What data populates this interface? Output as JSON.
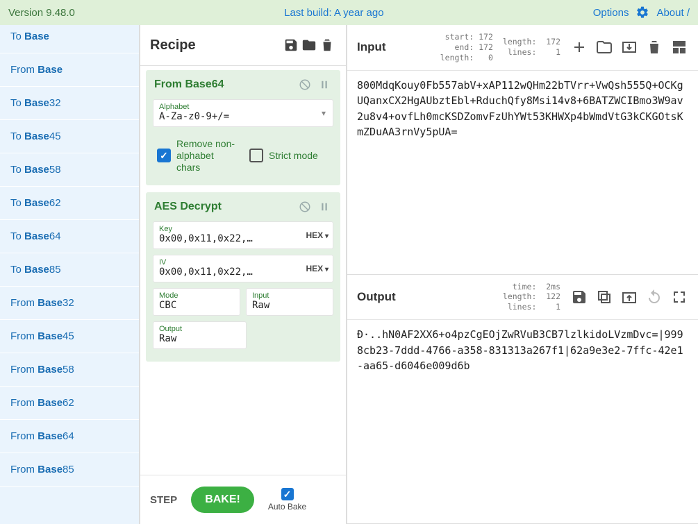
{
  "topbar": {
    "version": "Version 9.48.0",
    "last_build": "Last build: A year ago",
    "options": "Options",
    "about": "About /"
  },
  "sidebar": {
    "items": [
      {
        "pre": "To ",
        "bold": "Base",
        "partial": true
      },
      {
        "pre": "From ",
        "bold": "Base"
      },
      {
        "pre": "To ",
        "bold": "Base",
        "post": "32"
      },
      {
        "pre": "To ",
        "bold": "Base",
        "post": "45"
      },
      {
        "pre": "To ",
        "bold": "Base",
        "post": "58"
      },
      {
        "pre": "To ",
        "bold": "Base",
        "post": "62"
      },
      {
        "pre": "To ",
        "bold": "Base",
        "post": "64"
      },
      {
        "pre": "To ",
        "bold": "Base",
        "post": "85"
      },
      {
        "pre": "From ",
        "bold": "Base",
        "post": "32"
      },
      {
        "pre": "From ",
        "bold": "Base",
        "post": "45"
      },
      {
        "pre": "From ",
        "bold": "Base",
        "post": "58"
      },
      {
        "pre": "From ",
        "bold": "Base",
        "post": "62"
      },
      {
        "pre": "From ",
        "bold": "Base",
        "post": "64"
      },
      {
        "pre": "From ",
        "bold": "Base",
        "post": "85"
      }
    ]
  },
  "recipe": {
    "title": "Recipe",
    "ops": [
      {
        "name": "From Base64",
        "alphabet": {
          "label": "Alphabet",
          "value": "A-Za-z0-9+/="
        },
        "remove_label": "Remove non-alphabet chars",
        "remove_checked": true,
        "strict_label": "Strict mode",
        "strict_checked": false
      },
      {
        "name": "AES Decrypt",
        "key": {
          "label": "Key",
          "value": "0x00,0x11,0x22,…",
          "suffix": "HEX"
        },
        "iv": {
          "label": "IV",
          "value": "0x00,0x11,0x22,…",
          "suffix": "HEX"
        },
        "mode": {
          "label": "Mode",
          "value": "CBC"
        },
        "input": {
          "label": "Input",
          "value": "Raw"
        },
        "output": {
          "label": "Output",
          "value": "Raw"
        }
      }
    ],
    "step": "STEP",
    "bake": "BAKE!",
    "autobake": "Auto Bake",
    "autobake_checked": true
  },
  "input": {
    "title": "Input",
    "stats1": " start: 172\n   end: 172\nlength:   0",
    "stats2": "length:  172\n lines:    1",
    "text": "800MdqKouy0Fb557abV+xAP112wQHm22bTVrr+VwQsh555Q+OCKgUQanxCX2HgAUbztEbl+RduchQfy8Msi14v8+6BATZWCIBmo3W9av2u8v4+ovfLh0mcKSDZomvFzUhYWt53KHWXp4bWmdVtG3kCKGOtsKmZDuAA3rnVy5pUA="
  },
  "output": {
    "title": "Output",
    "stats": "  time:  2ms\nlength:  122\n lines:    1",
    "text": "Ð·..hN0AF2XX6+o4pzCgEOjZwRVuB3CB7lzlkidoLVzmDvc=|9998cb23-7ddd-4766-a358-831313a267f1|62a9e3e2-7ffc-42e1-aa65-d6046e009d6b"
  }
}
